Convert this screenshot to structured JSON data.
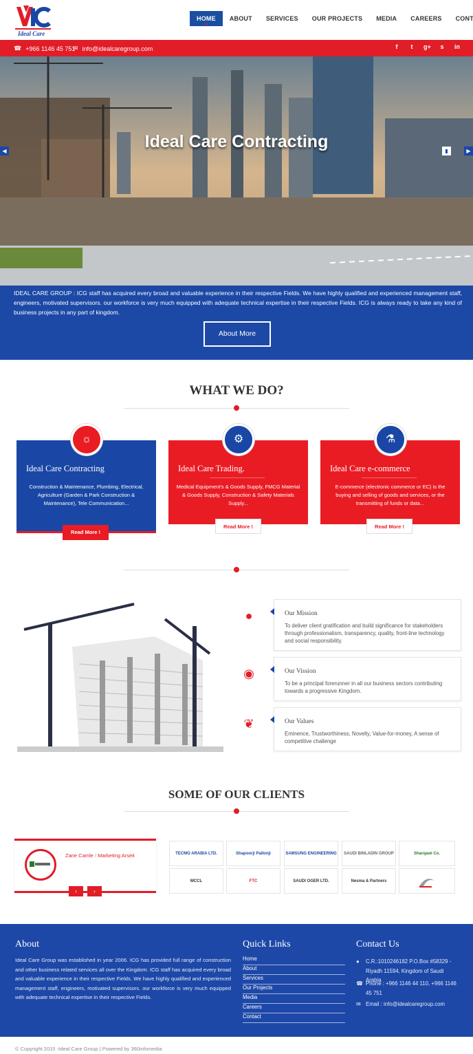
{
  "brand": {
    "logo_text": "Ideal Care",
    "logo_mark": "IC",
    "primary": "#1d49a6",
    "accent": "#e11d27"
  },
  "nav": {
    "items": [
      {
        "label": "HOME",
        "active": true
      },
      {
        "label": "ABOUT"
      },
      {
        "label": "SERVICES"
      },
      {
        "label": "OUR PROJECTS"
      },
      {
        "label": "MEDIA"
      },
      {
        "label": "CAREERS"
      },
      {
        "label": "CONTACT"
      }
    ]
  },
  "topbar": {
    "phone": "+966 1146 45 751",
    "email": "info@idealcaregroup.com",
    "social": [
      "f",
      "t",
      "g+",
      "s",
      "in"
    ]
  },
  "hero": {
    "title": "Ideal Care Contracting"
  },
  "intro": {
    "text": "IDEAL CARE GROUP : ICG staff has acquired every broad and valuable experience in their respective Fields. We have highly qualified and experienced management staff, engineers, motivated supervisors. our workforce is very much equipped with adequate technical expertise in their respective Fields. ICG is always ready to take any kind of business projects in any part of kingdom.",
    "button": "About More"
  },
  "services": {
    "title": "WHAT WE DO?",
    "cards": [
      {
        "title": "Ideal Care Contracting",
        "icon": "lightbulb-icon",
        "text": "Construction & Maintenance, Plumbing, Electrical, Agriculture (Garden & Park Construction & Maintenance), Tele Communication...",
        "button": "Read More !"
      },
      {
        "title": "Ideal Care Trading.",
        "icon": "gears-icon",
        "text": "Medical Equipment's & Goods Supply, FMCG Material & Goods Supply, Construction & Safety Materials Supply...",
        "button": "Read More !"
      },
      {
        "title": "Ideal Care e-commerce",
        "icon": "flask-icon",
        "text": "E-commerce (electronic commerce or EC) is the buying and selling of goods and services, or the transmitting of funds or data...",
        "button": "Read More !"
      }
    ]
  },
  "mission": {
    "items": [
      {
        "title": "Our Mission",
        "icon": "globe-icon",
        "text": "To deliver client gratification and build significance for stakeholders through professionalism, transparency, quality, front-line technology and social responsibility."
      },
      {
        "title": "Our Vission",
        "icon": "eye-icon",
        "text": "To be a principal forerunner in all our business sectors contributing towards a progressive Kingdom."
      },
      {
        "title": "Our Values",
        "icon": "leaf-icon",
        "text": "Eminence, Trustworthiness, Novelty, Value-for-money, A sense of competitive challenge"
      }
    ]
  },
  "clients": {
    "title": "SOME OF OUR CLIENTS",
    "testimonial": {
      "name": "Zane Camle",
      "role": "Marketing Arseit"
    },
    "logos": [
      "TECMO ARABIA LTD.",
      "Shapoorji Pallonji",
      "SAMSUNG ENGINEERING",
      "SAUDI BINLADIN GROUP",
      "Sharqawi Co.",
      "MCCL",
      "FTC",
      "SAUDI OGER LTD.",
      "Nesma & Partners",
      "client logo"
    ]
  },
  "footer": {
    "about_title": "About",
    "about_text": "Ideal Care Group was established in year 2006. ICG has provided full range of construction and other business related services all over the Kingdom. ICG staff has acquired every broad and valuable experience in their respective Fields. We have highly qualified and experienced management staff, engineers, motivated supervisors. our workforce is very much equipped with adequate technical expertise in their respective Fields.",
    "links_title": "Quick Links",
    "links": [
      "Home",
      "About",
      "Services",
      "Our Projects",
      "Media",
      "Careers",
      "Contact"
    ],
    "contact_title": "Contact Us",
    "address": "C.R.:1010246182 P.O.Box #58329 - Riyadh 11594, Kingdom of Saudi Arabia",
    "phone": "Phone : +966 1146 44 110, +966 1146 45 751",
    "email": "Email : info@idealcaregroup.com"
  },
  "copyright": "© Copyright 2015 -Ideal Care Group | Powered by 360infomedia"
}
